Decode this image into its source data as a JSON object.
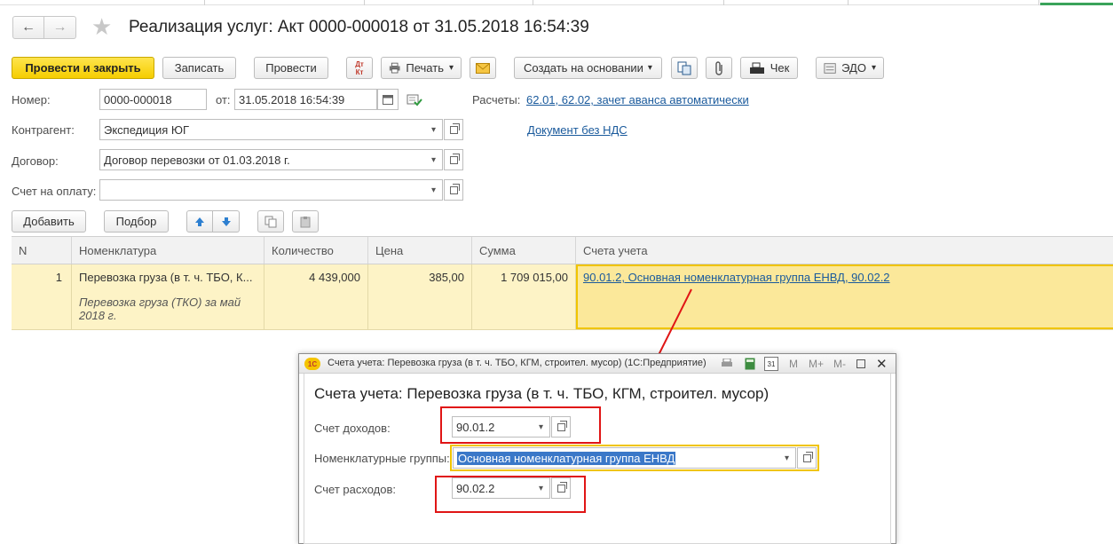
{
  "header": {
    "back_glyph": "←",
    "forward_glyph": "→",
    "star_glyph": "★",
    "title": "Реализация услуг: Акт 0000-000018 от 31.05.2018 16:54:39"
  },
  "toolbar": {
    "post_close": "Провести и закрыть",
    "save": "Записать",
    "post": "Провести",
    "dtkt_top": "Дт",
    "dtkt_bottom": "Кт",
    "print": "Печать",
    "create_based": "Создать на основании",
    "receipt": "Чек",
    "edo": "ЭДО",
    "dropdown_glyph": "▾"
  },
  "form": {
    "number_label": "Номер:",
    "number_value": "0000-000018",
    "from_label": "от:",
    "date_value": "31.05.2018 16:54:39",
    "settlements_label": "Расчеты:",
    "settlements_link": "62.01, 62.02, зачет аванса автоматически",
    "counterparty_label": "Контрагент:",
    "counterparty_value": "Экспедиция ЮГ",
    "vat_link": "Документ без НДС",
    "contract_label": "Договор:",
    "contract_value": "Договор перевозки от 01.03.2018 г.",
    "invoice_label": "Счет на оплату:",
    "invoice_value": ""
  },
  "table_toolbar": {
    "add": "Добавить",
    "pick": "Подбор"
  },
  "table": {
    "columns": [
      "N",
      "Номенклатура",
      "Количество",
      "Цена",
      "Сумма",
      "Счета учета"
    ],
    "rows": [
      {
        "n": "1",
        "item": "Перевозка груза (в т. ч. ТБО, К...",
        "item_note_line1": "Перевозка груза (ТКО)  за май",
        "item_note_line2": "2018 г.",
        "qty": "4 439,000",
        "price": "385,00",
        "sum": "1 709 015,00",
        "accounts": "90.01.2, Основная номенклатурная группа ЕНВД, 90.02.2"
      }
    ]
  },
  "dialog": {
    "logo": "1С",
    "window_title": "Счета учета: Перевозка груза (в т. ч. ТБО, КГМ, строител. мусор)  (1С:Предприятие)",
    "tb_m": "M",
    "tb_mplus": "M+",
    "tb_mminus": "M-",
    "calendar_day": "31",
    "heading": "Счета учета: Перевозка груза (в т. ч. ТБО, КГМ, строител. мусор)",
    "income_label": "Счет доходов:",
    "income_value": "90.01.2",
    "group_label": "Номенклатурные группы:",
    "group_value": "Основная номенклатурная группа ЕНВД",
    "expense_label": "Счет расходов:",
    "expense_value": "90.02.2"
  },
  "colors": {
    "primary_button": "#f5cd00",
    "selected_row": "#fdf3c6",
    "link": "#1a5a9c",
    "highlight_red": "#e01515",
    "focus_yellow": "#f0c400"
  }
}
